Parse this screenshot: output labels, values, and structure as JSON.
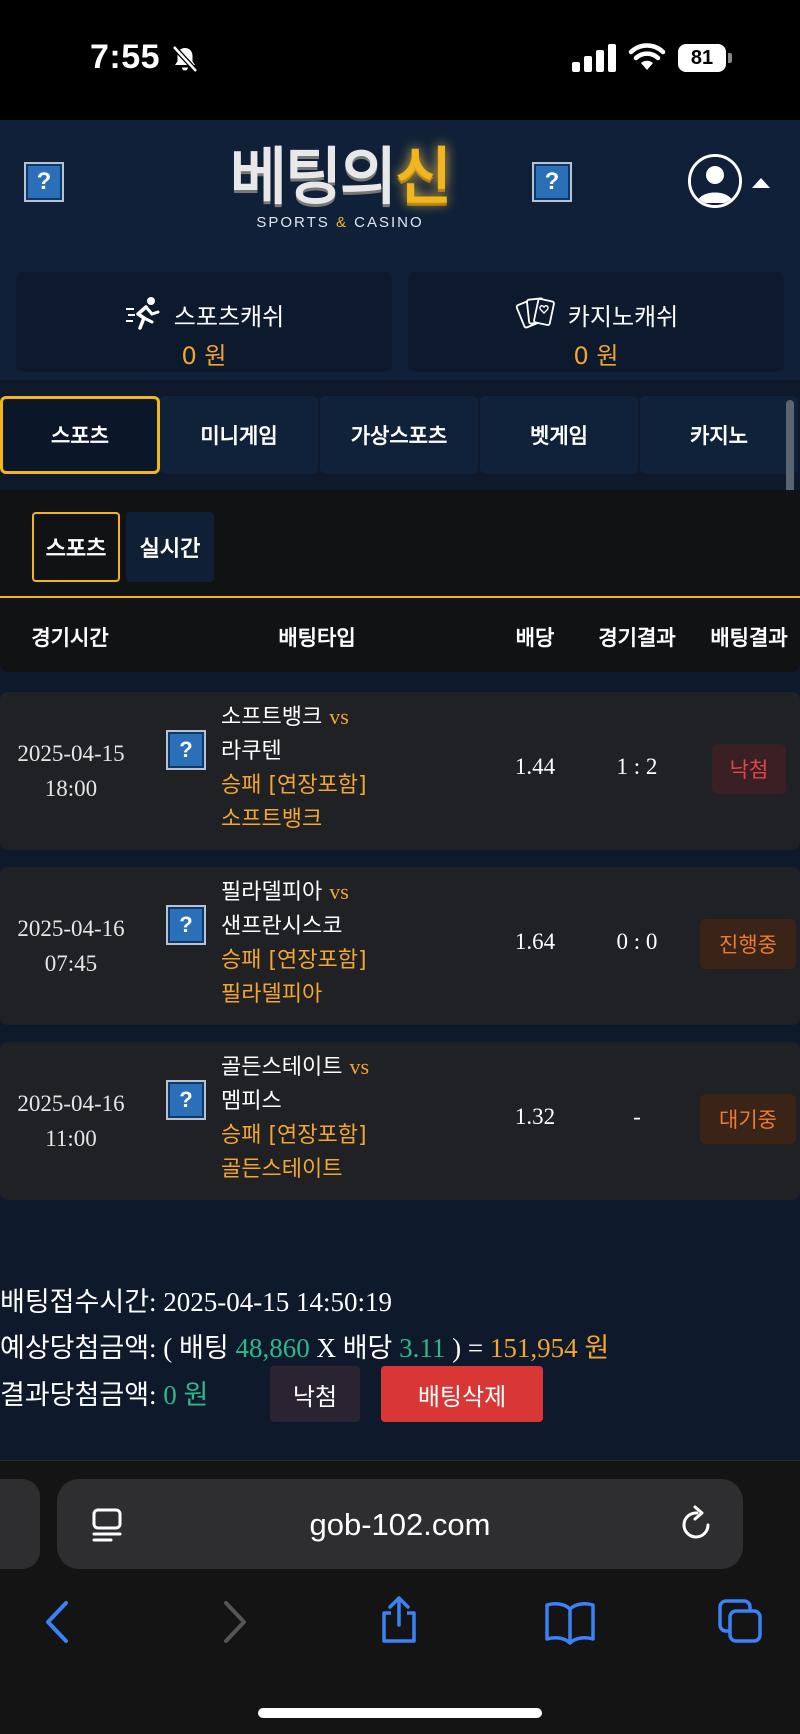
{
  "status_bar": {
    "time": "7:55",
    "battery": "81"
  },
  "header": {
    "logo_main_left": "베팅의",
    "logo_main_right": "신",
    "logo_sub_left": "SPORTS ",
    "logo_sub_amp": "&",
    "logo_sub_right": " CASINO",
    "icons": [
      "broken-image-icon",
      "broken-image-icon",
      "user-avatar-icon",
      "caret-up-icon"
    ]
  },
  "wallets": {
    "sports": {
      "label": "스포츠캐쉬",
      "value": "0 원"
    },
    "casino": {
      "label": "카지노캐쉬",
      "value": "0 원"
    }
  },
  "category_tabs": [
    "스포츠",
    "미니게임",
    "가상스포츠",
    "벳게임",
    "카지노"
  ],
  "sub_tabs": [
    "스포츠",
    "실시간"
  ],
  "table_headers": [
    "경기시간",
    "배팅타입",
    "배당",
    "경기결과",
    "배팅결과"
  ],
  "bets": [
    {
      "date": "2025-04-15",
      "time": "18:00",
      "home": "소프트뱅크",
      "vs": "vs",
      "away": "라쿠텐",
      "type": "승패 [연장포함]",
      "pick": "소프트뱅크",
      "odds": "1.44",
      "score": "1 : 2",
      "result": "낙첨"
    },
    {
      "date": "2025-04-16",
      "time": "07:45",
      "home": "필라델피아",
      "vs": "vs",
      "away": "샌프란시스코",
      "type": "승패 [연장포함]",
      "pick": "필라델피아",
      "odds": "1.64",
      "score": "0 : 0",
      "result": "진행중"
    },
    {
      "date": "2025-04-16",
      "time": "11:00",
      "home": "골든스테이트",
      "vs": "vs",
      "away": "멤피스",
      "type": "승패 [연장포함]",
      "pick": "골든스테이트",
      "odds": "1.32",
      "score": "-",
      "result": "대기중"
    }
  ],
  "summary": {
    "accept_label": "배팅접수시간:",
    "accept_time": "2025-04-15 14:50:19",
    "expected_label": "예상당첨금액:",
    "expected_open": "( 배팅",
    "bet_amount": "48,860",
    "expected_mid": "X 배당",
    "total_odds": "3.11",
    "expected_close": ") =",
    "expected_win": "151,954 원",
    "result_label": "결과당첨금액:",
    "result_value": "0 원",
    "status_button": "낙첨",
    "delete_button": "배팅삭제"
  },
  "browser": {
    "url": "gob-102.com"
  },
  "colors": {
    "accent_gold": "#f2b61c",
    "amount_orange": "#f2a531",
    "green": "#2eb88a",
    "lose_red": "#e04848",
    "delete_red": "#d93636"
  }
}
